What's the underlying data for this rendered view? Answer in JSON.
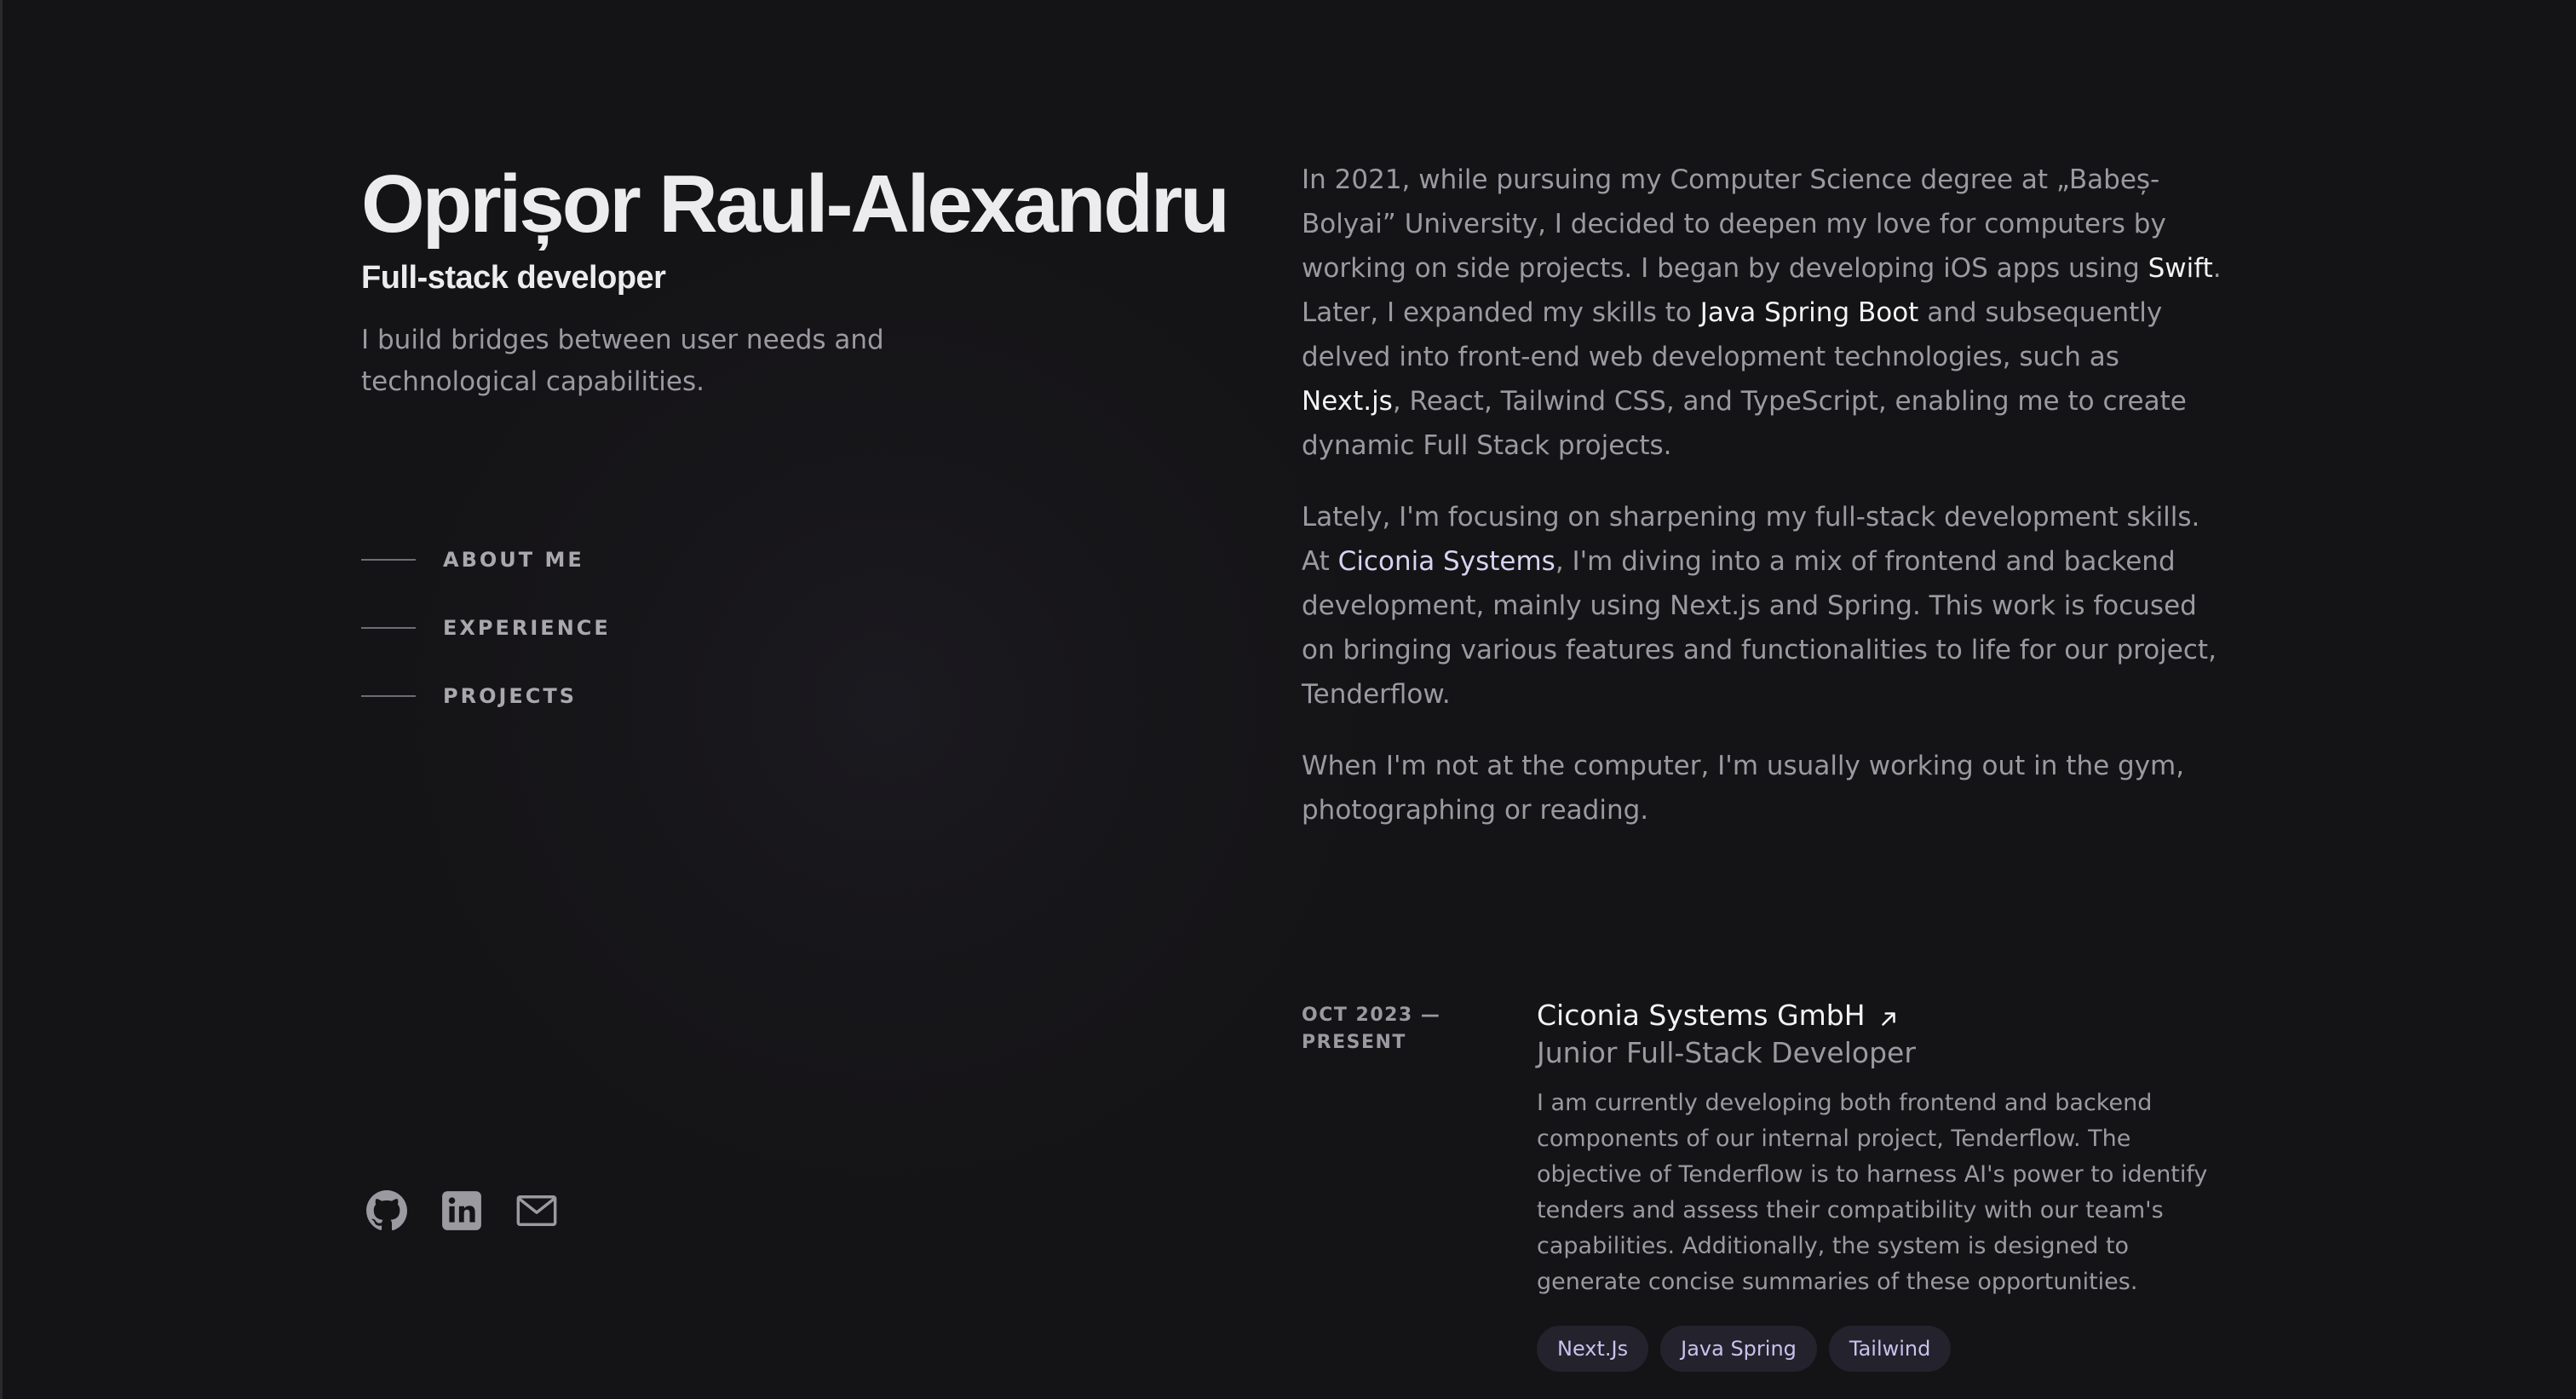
{
  "header": {
    "name": "Oprișor Raul-Alexandru",
    "role": "Full-stack developer",
    "tagline": "I build bridges between user needs and technological capabilities."
  },
  "nav": {
    "items": [
      {
        "label": "ABOUT ME"
      },
      {
        "label": "EXPERIENCE"
      },
      {
        "label": "PROJECTS"
      }
    ]
  },
  "socials": [
    {
      "icon": "github-icon"
    },
    {
      "icon": "linkedin-icon"
    },
    {
      "icon": "mail-icon"
    }
  ],
  "about": {
    "p1": {
      "a": "In 2021, while pursuing my Computer Science degree at „Babeș-Bolyai” University, I decided to deepen my love for computers by working on side projects. I began by developing iOS apps using ",
      "swift": "Swift",
      "b": ". Later, I expanded my skills to ",
      "spring": "Java Spring Boot",
      "c": " and subsequently delved into front-end web development technologies, such as ",
      "next": "Next.js",
      "d": ", React, Tailwind CSS, and TypeScript, enabling me to create dynamic Full Stack projects."
    },
    "p2": {
      "a": "Lately, I'm focusing on sharpening my full-stack development skills. At ",
      "company": "Ciconia Systems",
      "b": ", I'm diving into a mix of frontend and backend development, mainly using Next.js and Spring. This work is focused on bringing various features and functionalities to life for our project, Tenderflow."
    },
    "p3": "When I'm not at the computer, I'm usually working out in the gym, photographing or reading."
  },
  "experience": {
    "date": "OCT 2023 — PRESENT",
    "company": "Ciconia Systems GmbH",
    "role": "Junior Full-Stack Developer",
    "description": "I am currently developing both frontend and backend components of our internal project, Tenderflow. The objective of Tenderflow is to harness AI's power to identify tenders and assess their compatibility with our team's capabilities. Additionally, the system is designed to generate concise summaries of these opportunities.",
    "tags": [
      "Next.Js",
      "Java Spring",
      "Tailwind"
    ]
  },
  "colors": {
    "background": "#141315",
    "heading": "#ececee",
    "body_text": "#9b9aa0",
    "accent": "#d8d3f2",
    "tag_background": "#24222d",
    "tag_text": "#c8c2ec"
  }
}
